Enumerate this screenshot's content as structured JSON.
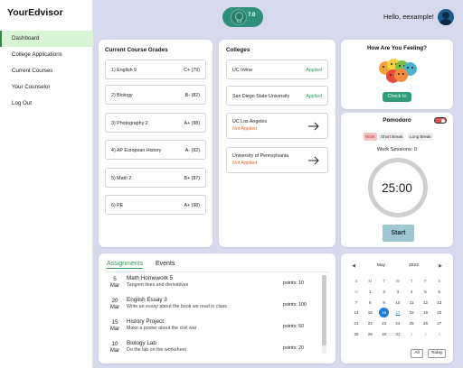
{
  "app": {
    "brand": "YourEdvisor"
  },
  "sidebar": {
    "items": [
      {
        "label": "Dashboard",
        "active": true
      },
      {
        "label": "College Applications",
        "active": false
      },
      {
        "label": "Current Courses",
        "active": false
      },
      {
        "label": "Your Counselor",
        "active": false
      },
      {
        "label": "Log Out",
        "active": false
      }
    ]
  },
  "header": {
    "score": "7.0",
    "greeting": "Hello, eexample!",
    "avatar_icon": "user-avatar-icon"
  },
  "grades": {
    "title": "Current Course Grades",
    "rows": [
      {
        "course": "1) English 9",
        "grade": "C+ (79)"
      },
      {
        "course": "2) Biology",
        "grade": "B- (82)"
      },
      {
        "course": "3) Photography 2",
        "grade": "A+ (98)"
      },
      {
        "course": "4) AP European History",
        "grade": "A- (92)"
      },
      {
        "course": "5) Math 2",
        "grade": "B+ (87)"
      },
      {
        "course": "6) PE",
        "grade": "A+ (98)"
      }
    ]
  },
  "colleges": {
    "title": "Colleges",
    "rows": [
      {
        "name": "UC Irvine",
        "status": "Applied"
      },
      {
        "name": "San Diego State University",
        "status": "Applied"
      },
      {
        "name": "UC Los Angeles",
        "status": "Not Applied"
      },
      {
        "name": "University of Pennsylvania",
        "status": "Not Applied"
      }
    ],
    "colors": {
      "applied": "#2e9b5a",
      "not_applied": "#e06a2a"
    }
  },
  "feeling": {
    "title": "How Are You Feeling?",
    "button": "Check In"
  },
  "pomodoro": {
    "title": "Pomodoro",
    "modes": [
      "Work",
      "Short Break",
      "Long Break"
    ],
    "sessions": "Work Sessions: 0",
    "timer": "25:00",
    "start": "Start"
  },
  "assignments": {
    "tabs": [
      "Assignments",
      "Events"
    ],
    "items": [
      {
        "day": "5",
        "month": "Mar",
        "title": "Math Homework 5",
        "desc": "Tangent lines and derivatives",
        "points": "points: 10"
      },
      {
        "day": "20",
        "month": "Mar",
        "title": "English Essay 3",
        "desc": "Write an essay about the book we read in class",
        "points": "points: 100"
      },
      {
        "day": "15",
        "month": "Mar",
        "title": "History Project",
        "desc": "Make a poster about the civil war",
        "points": "points: 50"
      },
      {
        "day": "10",
        "month": "Mar",
        "title": "Biology Lab",
        "desc": "Do the lab on the worksheet",
        "points": "points: 20"
      }
    ]
  },
  "calendar": {
    "month": "May",
    "year": "2023",
    "dow": [
      "S",
      "M",
      "T",
      "W",
      "T",
      "F",
      "S"
    ],
    "weeks": [
      [
        "30",
        "1",
        "2",
        "3",
        "4",
        "5",
        "6"
      ],
      [
        "7",
        "8",
        "9",
        "10",
        "11",
        "12",
        "13"
      ],
      [
        "14",
        "15",
        "16",
        "17",
        "18",
        "19",
        "20"
      ],
      [
        "21",
        "22",
        "23",
        "24",
        "25",
        "26",
        "27"
      ],
      [
        "28",
        "29",
        "30",
        "31",
        "1",
        "2",
        "3"
      ]
    ],
    "selected": "16",
    "today": "17",
    "buttons": [
      "All",
      "Today"
    ],
    "accent": "#1f7bd6"
  }
}
